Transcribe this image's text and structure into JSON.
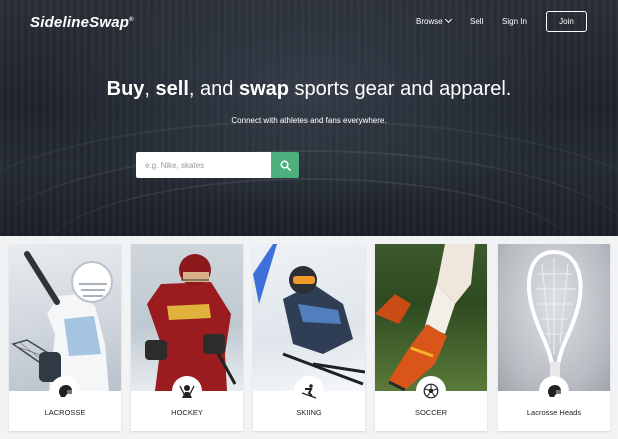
{
  "header": {
    "logo_text": "SidelineSwap",
    "logo_mark": "®",
    "nav": {
      "browse": "Browse",
      "sell": "Sell",
      "sign_in": "Sign In",
      "join": "Join"
    }
  },
  "hero": {
    "headline_parts": [
      "Buy",
      ", ",
      "sell",
      ", and ",
      "swap",
      " sports gear and apparel."
    ],
    "subline": "Connect with athletes and fans everywhere.",
    "search": {
      "placeholder": "e.g. Nike, skates",
      "button_icon": "search-icon"
    }
  },
  "categories": [
    {
      "label": "LACROSSE",
      "icon": "lacrosse-helmet-icon"
    },
    {
      "label": "HOCKEY",
      "icon": "hockey-icon"
    },
    {
      "label": "SKIING",
      "icon": "skier-icon"
    },
    {
      "label": "SOCCER",
      "icon": "soccer-ball-icon"
    },
    {
      "label": "Lacrosse Heads",
      "icon": "lacrosse-helmet-icon"
    }
  ],
  "colors": {
    "accent": "#4caf7d",
    "hero_bg": "#22272f"
  }
}
